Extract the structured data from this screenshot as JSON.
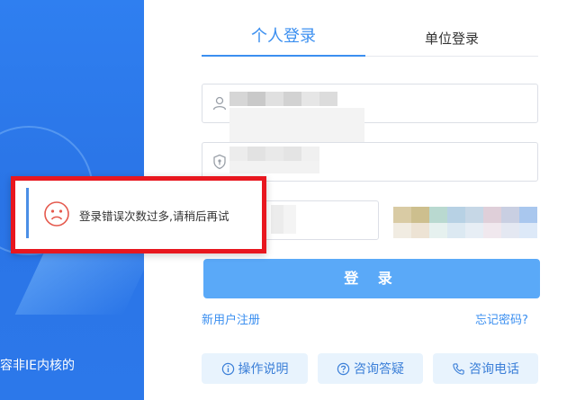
{
  "left_panel": {
    "browser_note": "容非IE内核的"
  },
  "tabs": {
    "personal_label": "个人登录",
    "unit_label": "单位登录"
  },
  "login_button": {
    "label": "登 录"
  },
  "links": {
    "register": "新用户注册",
    "forgot_password": "忘记密码?"
  },
  "help_buttons": [
    {
      "label": "操作说明",
      "icon": "info-circle-icon"
    },
    {
      "label": "咨询答疑",
      "icon": "question-circle-icon"
    },
    {
      "label": "咨询电话",
      "icon": "phone-icon"
    }
  ],
  "error_toast": {
    "message": "登录错误次数过多,请稍后再试",
    "icon": "sad-face-icon"
  },
  "colors": {
    "accent": "#3b8ff0",
    "button": "#5aa9f8",
    "error_border": "#e8171f",
    "panel_blue": "#2c78ea"
  }
}
